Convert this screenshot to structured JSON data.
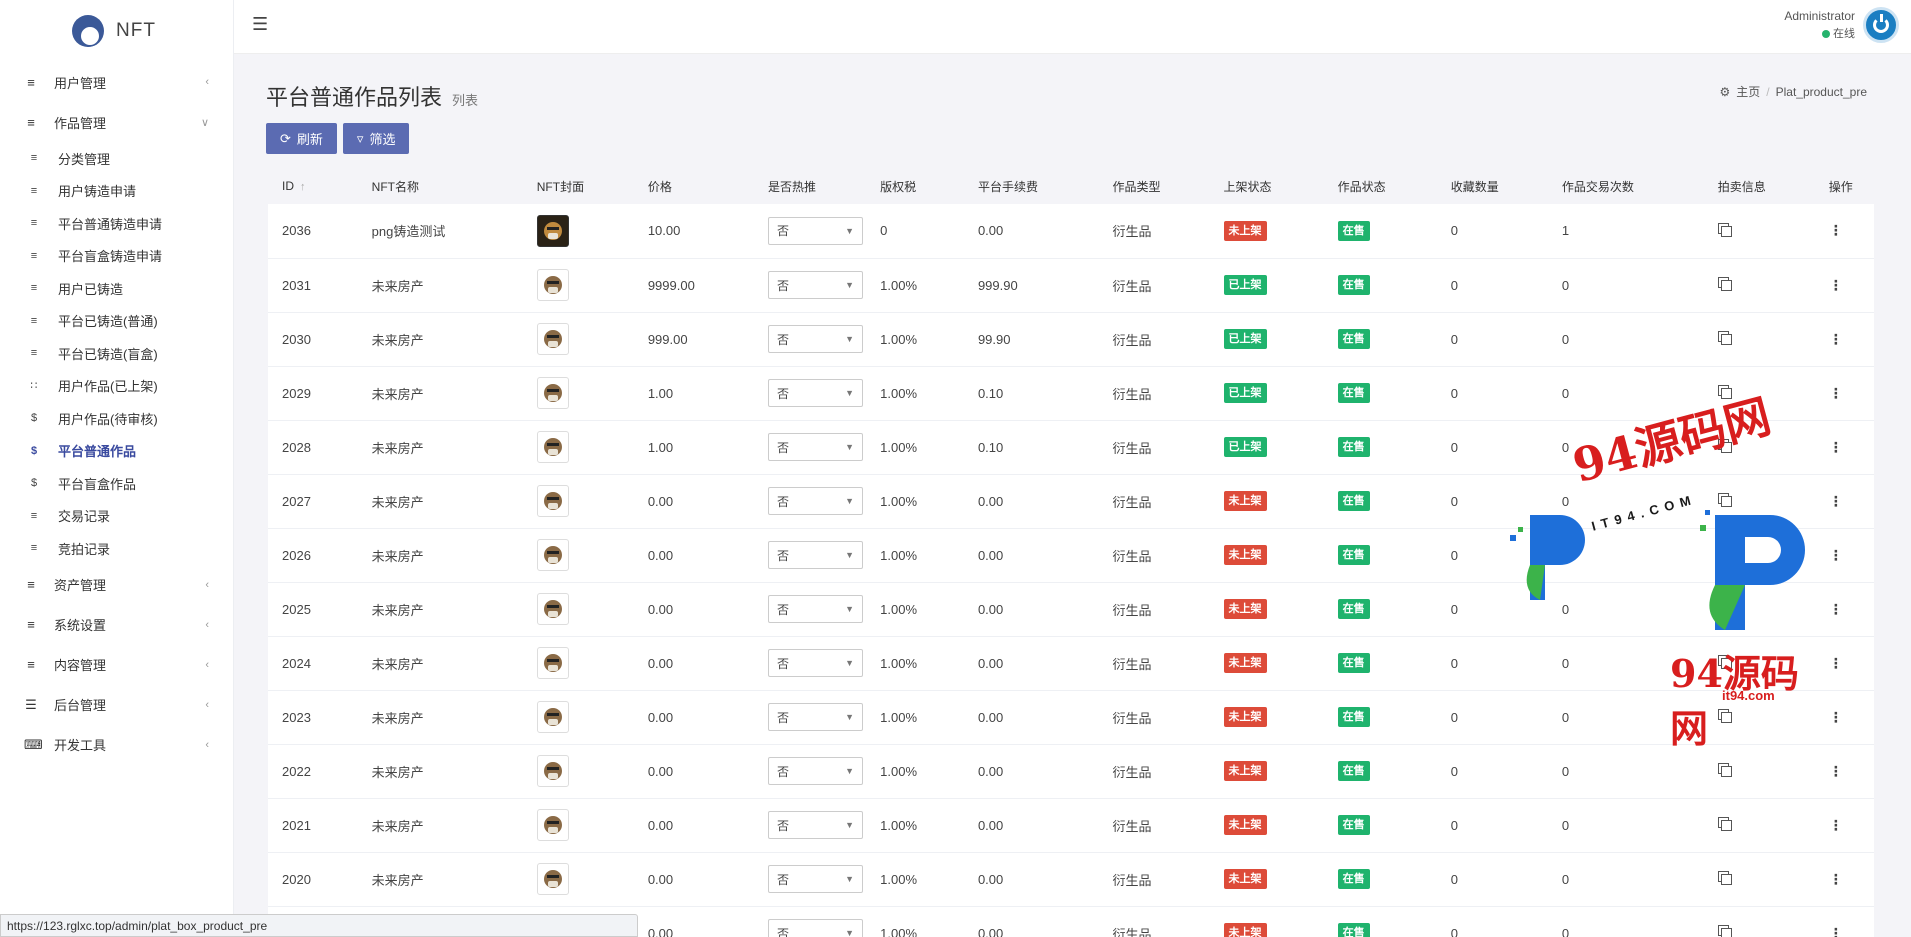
{
  "brand": {
    "name": "NFT"
  },
  "sidebar": {
    "groups_top": [
      {
        "label": "用户管理",
        "icon": "list-icon",
        "expanded": false
      }
    ],
    "works_group": {
      "label": "作品管理",
      "icon": "list-icon",
      "expanded": true
    },
    "sub_items": [
      {
        "label": "分类管理",
        "icon": "list-icon",
        "active": false
      },
      {
        "label": "用户铸造申请",
        "icon": "list-icon",
        "active": false
      },
      {
        "label": "平台普通铸造申请",
        "icon": "list-icon",
        "active": false
      },
      {
        "label": "平台盲盒铸造申请",
        "icon": "list-icon",
        "active": false
      },
      {
        "label": "用户已铸造",
        "icon": "list-icon",
        "active": false
      },
      {
        "label": "平台已铸造(普通)",
        "icon": "list-icon",
        "active": false
      },
      {
        "label": "平台已铸造(盲盒)",
        "icon": "list-icon",
        "active": false
      },
      {
        "label": "用户作品(已上架)",
        "icon": "grid-icon",
        "active": false
      },
      {
        "label": "用户作品(待审核)",
        "icon": "coin-icon",
        "active": false
      },
      {
        "label": "平台普通作品",
        "icon": "coin-icon",
        "active": true
      },
      {
        "label": "平台盲盒作品",
        "icon": "coin-icon",
        "active": false
      },
      {
        "label": "交易记录",
        "icon": "list-icon",
        "active": false
      },
      {
        "label": "竞拍记录",
        "icon": "list-icon",
        "active": false
      }
    ],
    "groups_bottom": [
      {
        "label": "资产管理",
        "icon": "list-icon"
      },
      {
        "label": "系统设置",
        "icon": "list-icon"
      },
      {
        "label": "内容管理",
        "icon": "list-icon"
      },
      {
        "label": "后台管理",
        "icon": "table-icon"
      },
      {
        "label": "开发工具",
        "icon": "keyboard-icon"
      }
    ]
  },
  "topbar": {
    "user_name": "Administrator",
    "user_status": "在线"
  },
  "header": {
    "title": "平台普通作品列表",
    "subtitle": "列表",
    "breadcrumb_home": "主页",
    "breadcrumb_current": "Plat_product_pre"
  },
  "toolbar": {
    "refresh_label": "刷新",
    "filter_label": "筛选"
  },
  "table": {
    "columns": [
      "ID",
      "NFT名称",
      "NFT封面",
      "价格",
      "是否热推",
      "版权税",
      "平台手续费",
      "作品类型",
      "上架状态",
      "作品状态",
      "收藏数量",
      "作品交易次数",
      "拍卖信息",
      "操作"
    ],
    "rows": [
      {
        "id": "2036",
        "name": "png铸造测试",
        "cover": "dark",
        "price": "10.00",
        "hot": "否",
        "royalty": "0",
        "fee": "0.00",
        "type": "衍生品",
        "listing": "未上架",
        "listing_color": "red",
        "status": "在售",
        "favorites": "0",
        "trades": "1"
      },
      {
        "id": "2031",
        "name": "未来房产",
        "cover": "light",
        "price": "9999.00",
        "hot": "否",
        "royalty": "1.00%",
        "fee": "999.90",
        "type": "衍生品",
        "listing": "已上架",
        "listing_color": "green",
        "status": "在售",
        "favorites": "0",
        "trades": "0"
      },
      {
        "id": "2030",
        "name": "未来房产",
        "cover": "light",
        "price": "999.00",
        "hot": "否",
        "royalty": "1.00%",
        "fee": "99.90",
        "type": "衍生品",
        "listing": "已上架",
        "listing_color": "green",
        "status": "在售",
        "favorites": "0",
        "trades": "0"
      },
      {
        "id": "2029",
        "name": "未来房产",
        "cover": "light",
        "price": "1.00",
        "hot": "否",
        "royalty": "1.00%",
        "fee": "0.10",
        "type": "衍生品",
        "listing": "已上架",
        "listing_color": "green",
        "status": "在售",
        "favorites": "0",
        "trades": "0"
      },
      {
        "id": "2028",
        "name": "未来房产",
        "cover": "light",
        "price": "1.00",
        "hot": "否",
        "royalty": "1.00%",
        "fee": "0.10",
        "type": "衍生品",
        "listing": "已上架",
        "listing_color": "green",
        "status": "在售",
        "favorites": "0",
        "trades": "0"
      },
      {
        "id": "2027",
        "name": "未来房产",
        "cover": "light",
        "price": "0.00",
        "hot": "否",
        "royalty": "1.00%",
        "fee": "0.00",
        "type": "衍生品",
        "listing": "未上架",
        "listing_color": "red",
        "status": "在售",
        "favorites": "0",
        "trades": "0"
      },
      {
        "id": "2026",
        "name": "未来房产",
        "cover": "light",
        "price": "0.00",
        "hot": "否",
        "royalty": "1.00%",
        "fee": "0.00",
        "type": "衍生品",
        "listing": "未上架",
        "listing_color": "red",
        "status": "在售",
        "favorites": "0",
        "trades": "0"
      },
      {
        "id": "2025",
        "name": "未来房产",
        "cover": "light",
        "price": "0.00",
        "hot": "否",
        "royalty": "1.00%",
        "fee": "0.00",
        "type": "衍生品",
        "listing": "未上架",
        "listing_color": "red",
        "status": "在售",
        "favorites": "0",
        "trades": "0"
      },
      {
        "id": "2024",
        "name": "未来房产",
        "cover": "light",
        "price": "0.00",
        "hot": "否",
        "royalty": "1.00%",
        "fee": "0.00",
        "type": "衍生品",
        "listing": "未上架",
        "listing_color": "red",
        "status": "在售",
        "favorites": "0",
        "trades": "0"
      },
      {
        "id": "2023",
        "name": "未来房产",
        "cover": "light",
        "price": "0.00",
        "hot": "否",
        "royalty": "1.00%",
        "fee": "0.00",
        "type": "衍生品",
        "listing": "未上架",
        "listing_color": "red",
        "status": "在售",
        "favorites": "0",
        "trades": "0"
      },
      {
        "id": "2022",
        "name": "未来房产",
        "cover": "light",
        "price": "0.00",
        "hot": "否",
        "royalty": "1.00%",
        "fee": "0.00",
        "type": "衍生品",
        "listing": "未上架",
        "listing_color": "red",
        "status": "在售",
        "favorites": "0",
        "trades": "0"
      },
      {
        "id": "2021",
        "name": "未来房产",
        "cover": "light",
        "price": "0.00",
        "hot": "否",
        "royalty": "1.00%",
        "fee": "0.00",
        "type": "衍生品",
        "listing": "未上架",
        "listing_color": "red",
        "status": "在售",
        "favorites": "0",
        "trades": "0"
      },
      {
        "id": "2020",
        "name": "未来房产",
        "cover": "light",
        "price": "0.00",
        "hot": "否",
        "royalty": "1.00%",
        "fee": "0.00",
        "type": "衍生品",
        "listing": "未上架",
        "listing_color": "red",
        "status": "在售",
        "favorites": "0",
        "trades": "0"
      },
      {
        "id": "",
        "name": "",
        "cover": "none",
        "price": "0.00",
        "hot": "否",
        "royalty": "1.00%",
        "fee": "0.00",
        "type": "衍生品",
        "listing": "未上架",
        "listing_color": "red",
        "status": "在售",
        "favorites": "0",
        "trades": "0"
      }
    ]
  },
  "watermark": {
    "top_text": "94源码网",
    "mid_text": "IT94.COM",
    "bottom_text": "94源码网",
    "url_text": "it94.com"
  },
  "statusbar": {
    "url": "https://123.rglxc.top/admin/plat_box_product_pre"
  },
  "colors": {
    "accent": "#5b6bb2",
    "red_badge": "#dd4b39",
    "green_badge": "#1fb36d",
    "active_menu": "#3a4a9f"
  }
}
